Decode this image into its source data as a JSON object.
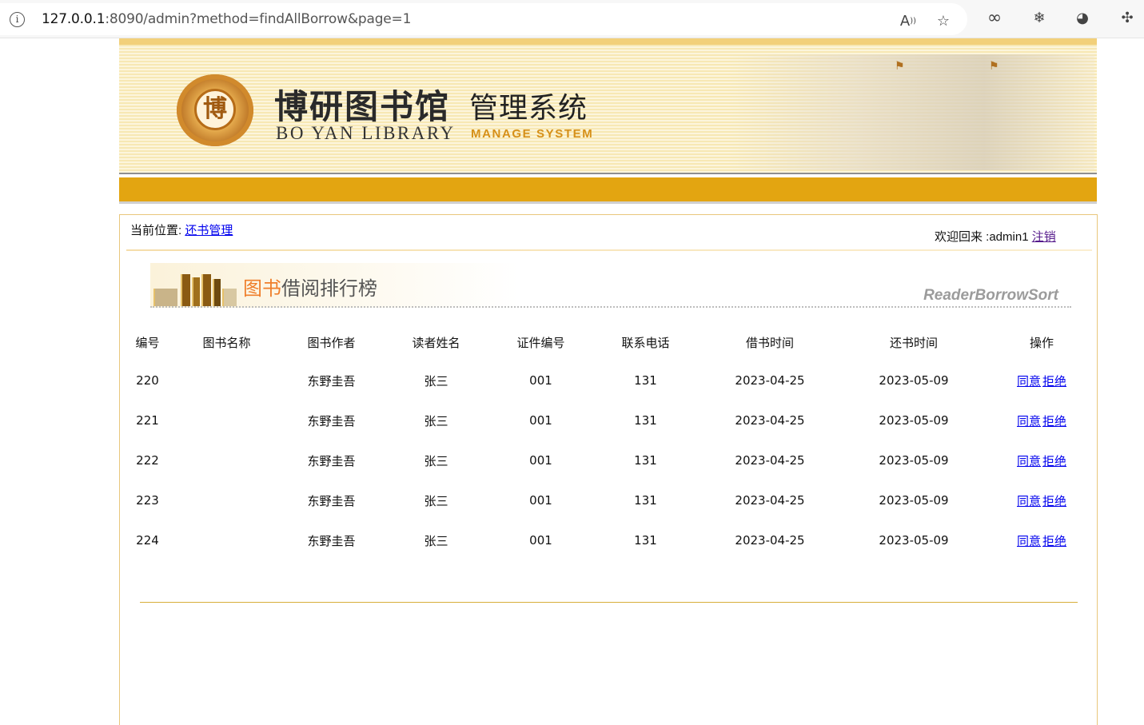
{
  "browser": {
    "url_host": "127.0.0.1",
    "url_rest": ":8090/admin?method=findAllBorrow&page=1",
    "icons": [
      "info-icon",
      "read-aloud-icon",
      "favorite-add-icon",
      "infinity-icon",
      "extension-icon",
      "extension-2-icon",
      "puzzle-icon"
    ]
  },
  "banner": {
    "seal_char": "博",
    "logo_cn": "博研图书馆",
    "logo_cn_sub": "管理系统",
    "logo_en": "BO YAN LIBRARY",
    "logo_en_sub": "MANAGE SYSTEM"
  },
  "location": {
    "label": "当前位置:",
    "link": "还书管理"
  },
  "welcome": {
    "text": "欢迎回来 :admin1",
    "logout": "注销"
  },
  "rank_banner": {
    "title_hl": "图书",
    "title_rest": "借阅排行榜",
    "subtitle_en": "ReaderBorrowSort"
  },
  "table": {
    "headers": [
      "编号",
      "图书名称",
      "图书作者",
      "读者姓名",
      "证件编号",
      "联系电话",
      "借书时间",
      "还书时间",
      "操作"
    ],
    "rows": [
      {
        "id": "220",
        "book": "",
        "author": "东野圭吾",
        "reader": "张三",
        "card": "001",
        "phone": "131",
        "borrow": "2023-04-25",
        "return": "2023-05-09"
      },
      {
        "id": "221",
        "book": "",
        "author": "东野圭吾",
        "reader": "张三",
        "card": "001",
        "phone": "131",
        "borrow": "2023-04-25",
        "return": "2023-05-09"
      },
      {
        "id": "222",
        "book": "",
        "author": "东野圭吾",
        "reader": "张三",
        "card": "001",
        "phone": "131",
        "borrow": "2023-04-25",
        "return": "2023-05-09"
      },
      {
        "id": "223",
        "book": "",
        "author": "东野圭吾",
        "reader": "张三",
        "card": "001",
        "phone": "131",
        "borrow": "2023-04-25",
        "return": "2023-05-09"
      },
      {
        "id": "224",
        "book": "",
        "author": "东野圭吾",
        "reader": "张三",
        "card": "001",
        "phone": "131",
        "borrow": "2023-04-25",
        "return": "2023-05-09"
      }
    ],
    "agree_label": "同意",
    "reject_label": "拒绝"
  },
  "colors": {
    "gold_bar": "#e3a511",
    "content_border": "#e9c77c",
    "link": "#0000ee"
  }
}
